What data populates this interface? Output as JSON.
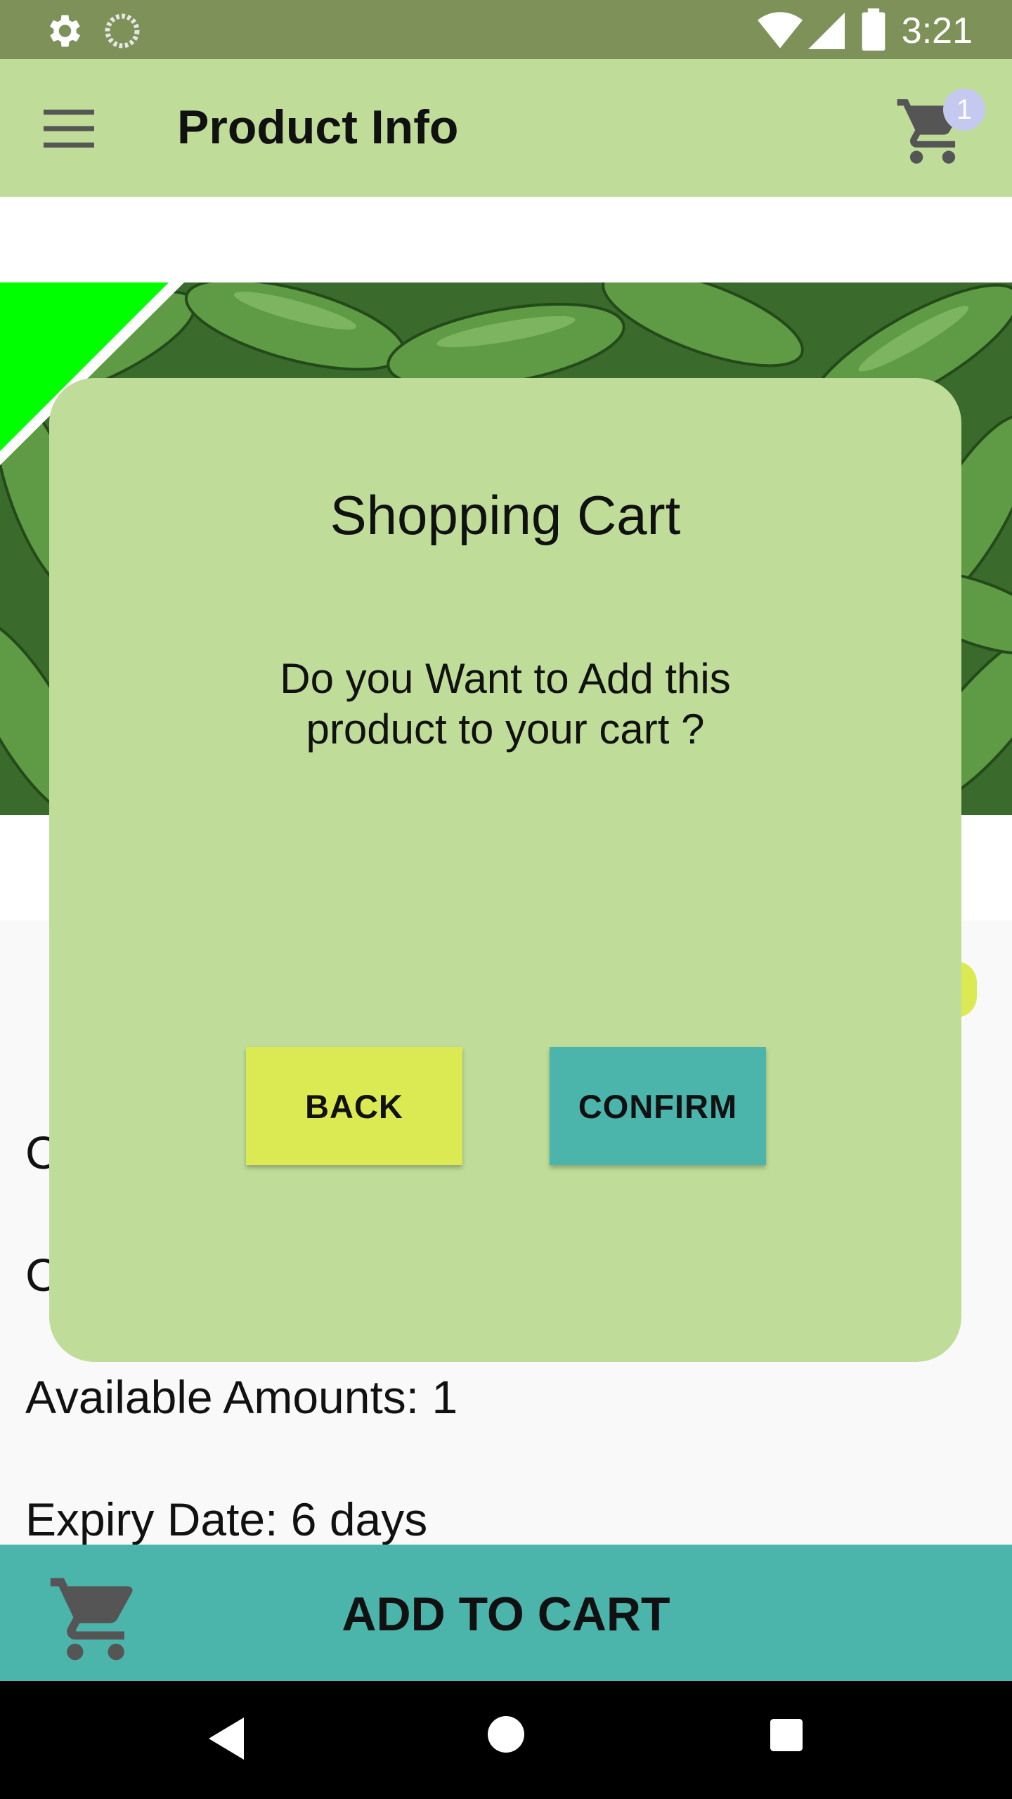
{
  "status_bar": {
    "time": "3:21"
  },
  "toolbar": {
    "title": "Product Info",
    "cart_count": "1"
  },
  "product": {
    "info_lines": [
      "C",
      "C",
      "Available Amounts: 1",
      "Expiry Date: 6 days"
    ]
  },
  "dialog": {
    "title": "Shopping Cart",
    "message_line1": "Do you Want to Add this",
    "message_line2": "product to your cart ?",
    "back_label": "BACK",
    "confirm_label": "CONFIRM"
  },
  "add_bar": {
    "label": "ADD TO CART"
  },
  "colors": {
    "status_bar": "#7d9158",
    "toolbar": "#bfdd99",
    "back_button": "#dbea52",
    "confirm_button": "#4bb5ac",
    "add_bar": "#4bb5ac"
  }
}
